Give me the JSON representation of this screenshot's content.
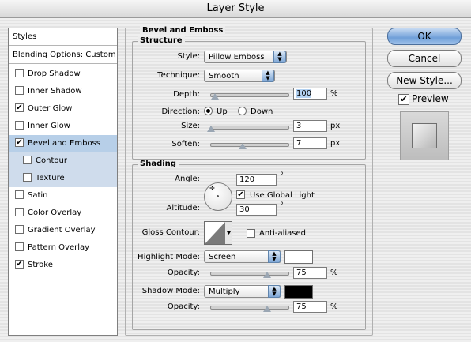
{
  "window": {
    "title": "Layer Style"
  },
  "styles_panel": {
    "header": "Styles",
    "blending": "Blending Options: Custom",
    "items": [
      {
        "label": "Drop Shadow",
        "checked": ""
      },
      {
        "label": "Inner Shadow",
        "checked": ""
      },
      {
        "label": "Outer Glow",
        "checked": "✔"
      },
      {
        "label": "Inner Glow",
        "checked": ""
      },
      {
        "label": "Bevel and Emboss",
        "checked": "✔"
      },
      {
        "label": "Contour",
        "checked": ""
      },
      {
        "label": "Texture",
        "checked": ""
      },
      {
        "label": "Satin",
        "checked": ""
      },
      {
        "label": "Color Overlay",
        "checked": ""
      },
      {
        "label": "Gradient Overlay",
        "checked": ""
      },
      {
        "label": "Pattern Overlay",
        "checked": ""
      },
      {
        "label": "Stroke",
        "checked": "✔"
      }
    ]
  },
  "bevel": {
    "title": "Bevel and Emboss",
    "structure": {
      "title": "Structure",
      "style_label": "Style:",
      "style_value": "Pillow Emboss",
      "technique_label": "Technique:",
      "technique_value": "Smooth",
      "depth_label": "Depth:",
      "depth_value": "100",
      "depth_unit": "%",
      "direction_label": "Direction:",
      "direction_up": "Up",
      "direction_down": "Down",
      "size_label": "Size:",
      "size_value": "3",
      "size_unit": "px",
      "soften_label": "Soften:",
      "soften_value": "7",
      "soften_unit": "px"
    },
    "shading": {
      "title": "Shading",
      "angle_label": "Angle:",
      "angle_value": "120",
      "degree": "°",
      "use_global_light_label": "Use Global Light",
      "use_global_light_check": "✔",
      "altitude_label": "Altitude:",
      "altitude_value": "30",
      "gloss_contour_label": "Gloss Contour:",
      "anti_aliased_label": "Anti-aliased",
      "highlight_mode_label": "Highlight Mode:",
      "highlight_mode_value": "Screen",
      "highlight_color": "#ffffff",
      "highlight_opacity_label": "Opacity:",
      "highlight_opacity_value": "75",
      "highlight_opacity_unit": "%",
      "shadow_mode_label": "Shadow Mode:",
      "shadow_mode_value": "Multiply",
      "shadow_color": "#000000",
      "shadow_opacity_label": "Opacity:",
      "shadow_opacity_value": "75",
      "shadow_opacity_unit": "%"
    }
  },
  "buttons": {
    "ok": "OK",
    "cancel": "Cancel",
    "new_style": "New Style...",
    "preview_label": "Preview",
    "preview_check": "✔"
  },
  "colors": {
    "accent": "#6f9fd8",
    "selection": "#b7cfe8"
  }
}
